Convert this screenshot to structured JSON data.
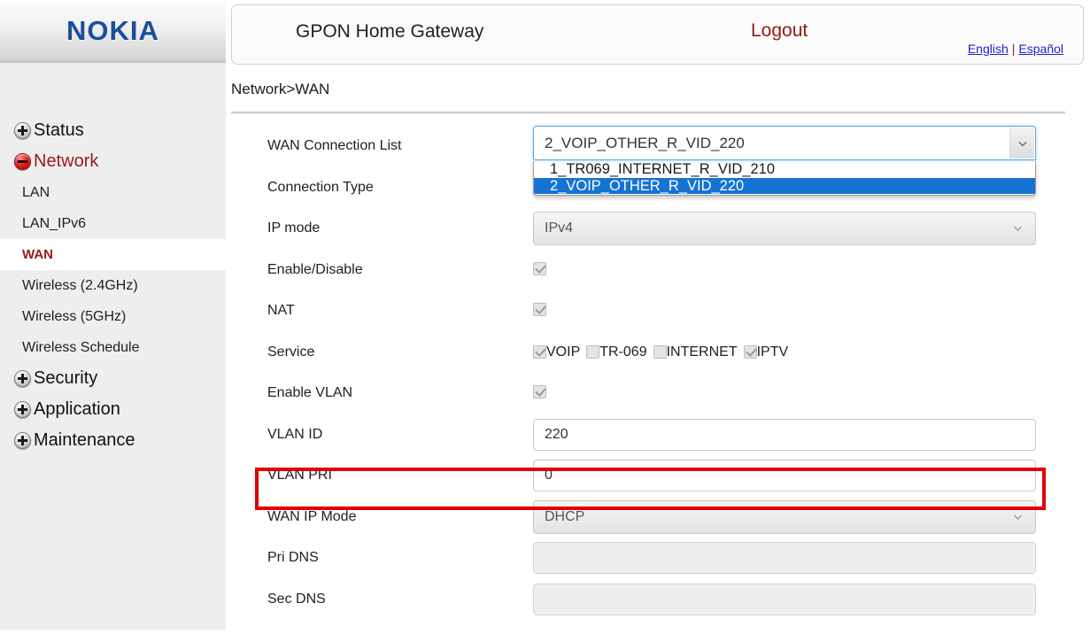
{
  "brand": {
    "logo_text": "NOKIA",
    "logo_color": "#1a4f9c"
  },
  "header": {
    "title": "GPON Home Gateway",
    "logout_label": "Logout",
    "logout_color": "#8f1d0e",
    "languages": {
      "english": "English",
      "separator": "|",
      "espanol": "Español"
    }
  },
  "breadcrumb": "Network>WAN",
  "sidebar": {
    "items": [
      {
        "label": "Status",
        "type": "top",
        "icon": "plus-orb-icon",
        "state": "collapsed"
      },
      {
        "label": "Network",
        "type": "top",
        "icon": "minus-orb-icon",
        "state": "expanded"
      },
      {
        "label": "LAN",
        "type": "sub",
        "state": "normal"
      },
      {
        "label": "LAN_IPv6",
        "type": "sub",
        "state": "normal"
      },
      {
        "label": "WAN",
        "type": "sub",
        "state": "active"
      },
      {
        "label": "Wireless (2.4GHz)",
        "type": "sub",
        "state": "normal"
      },
      {
        "label": "Wireless (5GHz)",
        "type": "sub",
        "state": "normal"
      },
      {
        "label": "Wireless Schedule",
        "type": "sub",
        "state": "normal"
      },
      {
        "label": "Security",
        "type": "top",
        "icon": "plus-orb-icon",
        "state": "collapsed"
      },
      {
        "label": "Application",
        "type": "top",
        "icon": "plus-orb-icon",
        "state": "collapsed"
      },
      {
        "label": "Maintenance",
        "type": "top",
        "icon": "plus-orb-icon",
        "state": "collapsed"
      }
    ]
  },
  "form": {
    "wan_connection_list": {
      "label": "WAN Connection List",
      "value": "2_VOIP_OTHER_R_VID_220",
      "expanded": true,
      "options": [
        {
          "label": "1_TR069_INTERNET_R_VID_210",
          "selected": false
        },
        {
          "label": "2_VOIP_OTHER_R_VID_220",
          "selected": true
        }
      ],
      "highlight_color": "#1573d4"
    },
    "connection_type": {
      "label": "Connection Type",
      "value": ""
    },
    "ip_mode": {
      "label": "IP mode",
      "value": "IPv4",
      "disabled": true
    },
    "enable_disable": {
      "label": "Enable/Disable",
      "checked": true,
      "disabled": true
    },
    "nat": {
      "label": "NAT",
      "checked": true,
      "disabled": true
    },
    "service": {
      "label": "Service",
      "items": [
        {
          "label": "VOIP",
          "checked": true,
          "disabled": true
        },
        {
          "label": "TR-069",
          "checked": false,
          "disabled": true
        },
        {
          "label": "INTERNET",
          "checked": false,
          "disabled": true
        },
        {
          "label": "IPTV",
          "checked": true,
          "disabled": true
        }
      ]
    },
    "enable_vlan": {
      "label": "Enable VLAN",
      "checked": true,
      "disabled": true
    },
    "vlan_id": {
      "label": "VLAN ID",
      "value": "220",
      "disabled": false
    },
    "vlan_pri": {
      "label": "VLAN PRI",
      "value": "0",
      "disabled": false,
      "highlighted": true
    },
    "wan_ip_mode": {
      "label": "WAN IP Mode",
      "value": "DHCP",
      "disabled": true
    },
    "pri_dns": {
      "label": "Pri DNS",
      "value": "",
      "disabled": true
    },
    "sec_dns": {
      "label": "Sec DNS",
      "value": "",
      "disabled": true
    }
  },
  "annotation": {
    "target": "vlan-pri-row",
    "color": "#e00000"
  }
}
